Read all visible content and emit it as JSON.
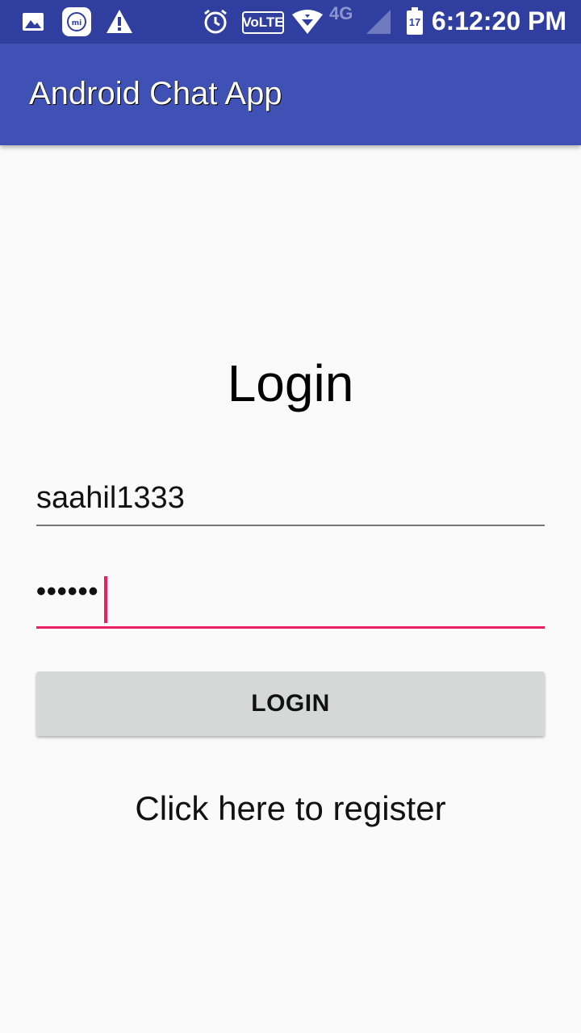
{
  "status_bar": {
    "time": "6:12:20 PM",
    "volte_label": "VoLTE",
    "network_label": "4G",
    "battery_level": "17",
    "icons": [
      "gallery-icon",
      "mi-icon",
      "warning-icon",
      "alarm-icon",
      "volte-icon",
      "wifi-icon",
      "4g-signal-icon",
      "battery-icon"
    ]
  },
  "app_bar": {
    "title": "Android Chat App"
  },
  "login": {
    "heading": "Login",
    "username_value": "saahil1333",
    "password_mask": "••••••",
    "button_label": "LOGIN",
    "register_text": "Click here to register"
  },
  "colors": {
    "status_bar": "#303f9f",
    "app_bar": "#3f51b5",
    "accent": "#e91e63",
    "background": "#fafafa",
    "button": "#d6d7d7"
  }
}
